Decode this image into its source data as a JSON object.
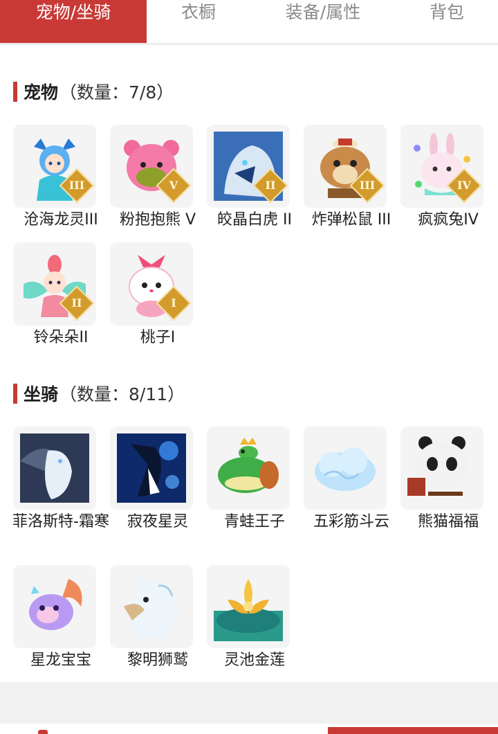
{
  "tabs": [
    {
      "label": "宠物/坐骑",
      "active": true
    },
    {
      "label": "衣橱",
      "active": false
    },
    {
      "label": "装备/属性",
      "active": false
    },
    {
      "label": "背包",
      "active": false
    }
  ],
  "pets": {
    "title": "宠物",
    "count": "（数量：7/8）",
    "items": [
      {
        "name": "沧海龙灵III",
        "grade": "III",
        "icon": "pet-blue-dragon-girl"
      },
      {
        "name": "粉抱抱熊 V",
        "grade": "V",
        "icon": "pet-pink-bear"
      },
      {
        "name": "皎晶白虎 II",
        "grade": "II",
        "icon": "pet-white-tiger"
      },
      {
        "name": "炸弹松鼠 III",
        "grade": "III",
        "icon": "pet-bomb-squirrel"
      },
      {
        "name": "疯疯兔IV",
        "grade": "IV",
        "icon": "pet-crazy-rabbit"
      },
      {
        "name": "铃朵朵II",
        "grade": "II",
        "icon": "pet-flower-fairy"
      },
      {
        "name": "桃子I",
        "grade": "I",
        "icon": "pet-peach-cat"
      }
    ]
  },
  "mounts": {
    "title": "坐骑",
    "count": "（数量：8/11）",
    "items": [
      {
        "name": "菲洛斯特-霜寒",
        "icon": "mount-frost-dragon"
      },
      {
        "name": "寂夜星灵",
        "icon": "mount-night-star-fox"
      },
      {
        "name": "青蛙王子",
        "icon": "mount-frog-prince"
      },
      {
        "name": "五彩筋斗云",
        "icon": "mount-cloud"
      },
      {
        "name": "熊猫福福",
        "icon": "mount-panda"
      },
      {
        "name": "星龙宝宝",
        "icon": "mount-star-dragon-baby"
      },
      {
        "name": "黎明狮鹫",
        "icon": "mount-dawn-griffin"
      },
      {
        "name": "灵池金莲",
        "icon": "mount-golden-lotus"
      }
    ]
  },
  "colors": {
    "accent": "#c93a36",
    "badge": "#d39b2c"
  }
}
